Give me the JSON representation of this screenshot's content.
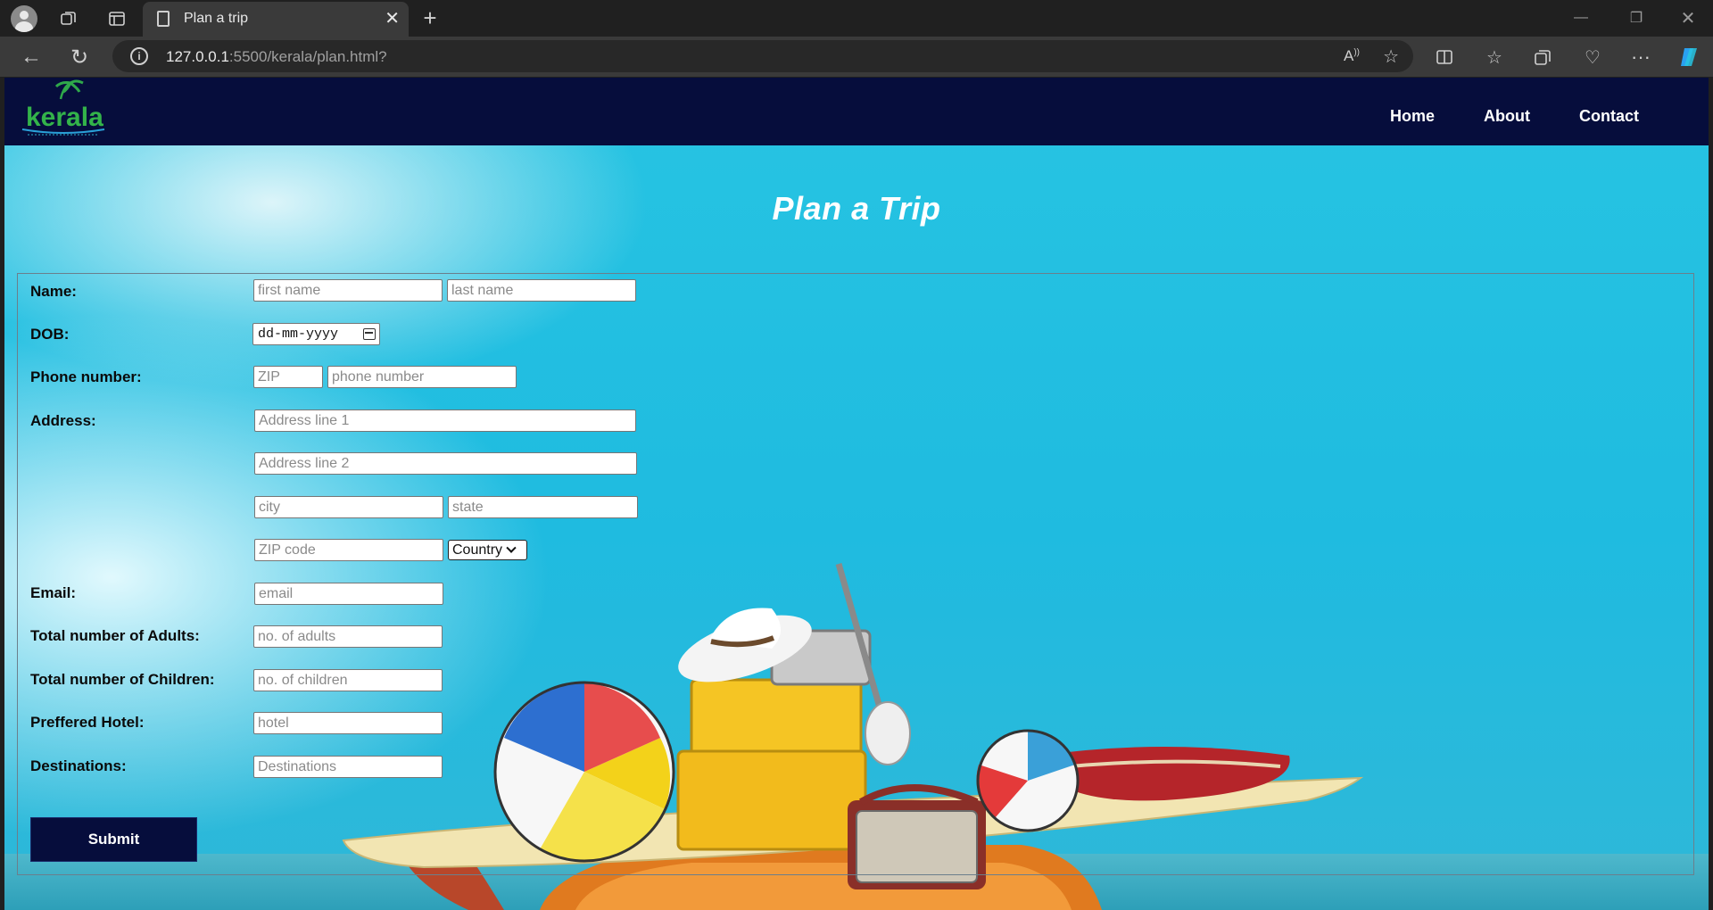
{
  "browser": {
    "tab_title": "Plan a trip",
    "url_host": "127.0.0.1",
    "url_rest": ":5500/kerala/plan.html?",
    "profile_icon": "profile-avatar-icon"
  },
  "nav": {
    "logo_alt": "kerala",
    "links": [
      "Home",
      "About",
      "Contact"
    ]
  },
  "page": {
    "title": "Plan a Trip"
  },
  "form": {
    "labels": {
      "name": "Name:",
      "dob": "DOB:",
      "phone": "Phone number:",
      "address": "Address:",
      "email": "Email:",
      "adults": "Total number of Adults:",
      "children": "Total number of Children:",
      "hotel": "Preffered Hotel:",
      "destinations": "Destinations:"
    },
    "placeholders": {
      "first_name": "first name",
      "last_name": "last name",
      "zip": "ZIP",
      "phone": "phone number",
      "address1": "Address line 1",
      "address2": "Address line 2",
      "city": "city",
      "state": "state",
      "zip_code": "ZIP code",
      "email": "email",
      "adults": "no. of adults",
      "children": "no. of children",
      "hotel": "hotel",
      "destinations": "Destinations"
    },
    "dob_value": "dd-mm-yyyy",
    "country_selected": "Country",
    "submit_label": "Submit"
  },
  "colors": {
    "navbar": "#060d3c",
    "sky": "#1fbbe0",
    "button": "#060d3c"
  }
}
